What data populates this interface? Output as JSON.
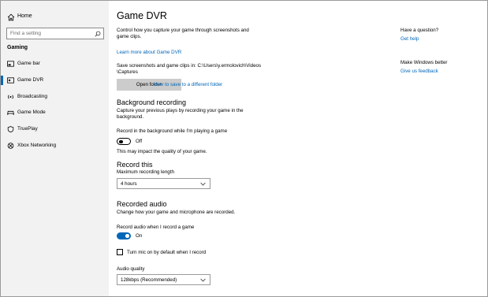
{
  "sidebar": {
    "home_label": "Home",
    "search_placeholder": "Find a setting",
    "section_title": "Gaming",
    "items": [
      {
        "label": "Game bar",
        "icon": "game-bar-icon"
      },
      {
        "label": "Game DVR",
        "icon": "game-dvr-icon",
        "selected": true
      },
      {
        "label": "Broadcasting",
        "icon": "broadcasting-icon"
      },
      {
        "label": "Game Mode",
        "icon": "game-mode-icon"
      },
      {
        "label": "TruePlay",
        "icon": "trueplay-icon"
      },
      {
        "label": "Xbox Networking",
        "icon": "xbox-icon"
      }
    ],
    "accent_color": "#0067b8"
  },
  "main": {
    "title": "Game DVR",
    "intro_line1": "Control how you capture your game through screenshots and",
    "intro_line2": "game clips.",
    "learn_more_link": "Learn more about Game DVR",
    "save_path_line1": "Save screenshots and game clips in: C:\\Users\\y.ermolovich\\Videos",
    "save_path_line2": "\\Captures",
    "open_folder_button": "Open folder",
    "save_different_link": "How to save to a different folder",
    "background_recording": {
      "heading": "Background recording",
      "desc_line1": "Capture your previous plays by recording your game in the",
      "desc_line2": "background.",
      "toggle_label": "Record in the background while I'm playing a game",
      "toggle_state": "Off",
      "note": "This may impact the quality of your game."
    },
    "record_this": {
      "heading": "Record this",
      "max_length_label": "Maximum recording length",
      "max_length_value": "4 hours"
    },
    "recorded_audio": {
      "heading": "Recorded audio",
      "desc": "Change how your game and microphone are recorded.",
      "toggle_label": "Record audio when I record a game",
      "toggle_state": "On",
      "mic_checkbox_label": "Turn mic on by default when I record",
      "quality_label": "Audio quality",
      "quality_value": "128kbps (Recommended)"
    }
  },
  "right": {
    "question_heading": "Have a question?",
    "help_link": "Get help",
    "better_heading": "Make Windows better",
    "feedback_link": "Give us feedback"
  }
}
